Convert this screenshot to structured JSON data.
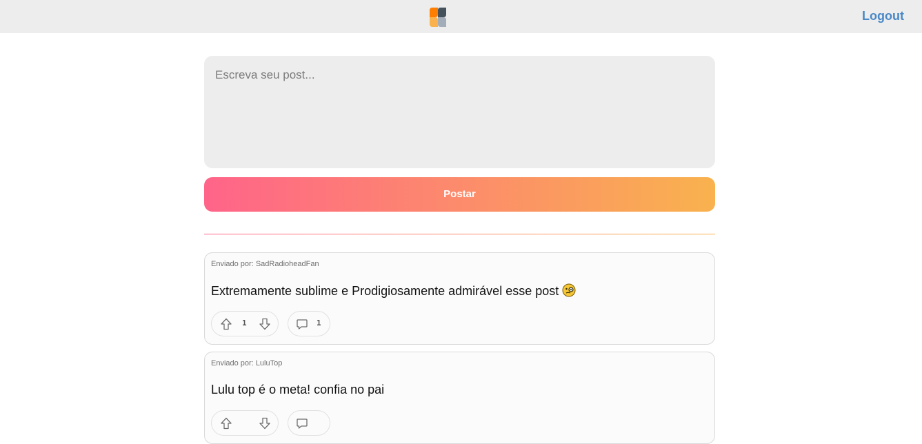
{
  "header": {
    "logo_icon": "labeddit-logo-icon",
    "logout_label": "Logout"
  },
  "composer": {
    "placeholder": "Escreva seu post...",
    "value": "",
    "submit_label": "Postar"
  },
  "posts": [
    {
      "author": "Enviado por: SadRadioheadFan",
      "content": "Extremamente sublime e Prodigiosamente admirável esse post",
      "emoji": "face-with-monocle-icon",
      "upvotes": "1",
      "comments": "1"
    },
    {
      "author": "Enviado por: LuluTop",
      "content": "Lulu top é o meta! confia no pai",
      "upvotes": "",
      "comments": ""
    }
  ],
  "colors": {
    "header_bg": "#ededed",
    "link": "#4a88c7",
    "gradient_start": "#ff6489",
    "gradient_end": "#f9b24e"
  }
}
